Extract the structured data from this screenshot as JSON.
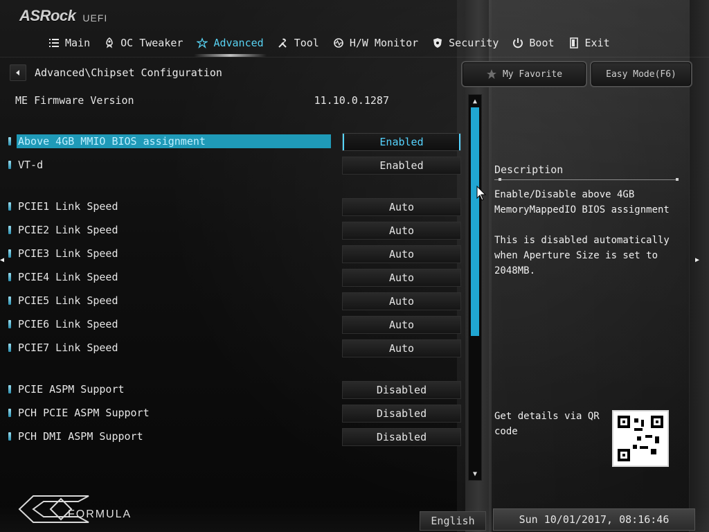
{
  "brand": {
    "name": "ASRock",
    "suffix": "UEFI"
  },
  "nav": {
    "items": [
      {
        "label": "Main",
        "icon": "list-icon"
      },
      {
        "label": "OC Tweaker",
        "icon": "rocket-icon"
      },
      {
        "label": "Advanced",
        "icon": "star-icon"
      },
      {
        "label": "Tool",
        "icon": "tools-icon"
      },
      {
        "label": "H/W Monitor",
        "icon": "monitor-icon"
      },
      {
        "label": "Security",
        "icon": "shield-icon"
      },
      {
        "label": "Boot",
        "icon": "power-icon"
      },
      {
        "label": "Exit",
        "icon": "exit-icon"
      }
    ],
    "active_index": 2,
    "accent": "#58d2f2"
  },
  "breadcrumb": {
    "path": "Advanced\\Chipset Configuration"
  },
  "firmware": {
    "label": "ME Firmware Version",
    "value": "11.10.0.1287"
  },
  "settings": [
    {
      "label": "Above 4GB MMIO BIOS assignment",
      "value": "Enabled",
      "selected": true
    },
    {
      "label": "VT-d",
      "value": "Enabled"
    },
    {
      "label": "PCIE1 Link Speed",
      "value": "Auto"
    },
    {
      "label": "PCIE2 Link Speed",
      "value": "Auto"
    },
    {
      "label": "PCIE3 Link Speed",
      "value": "Auto"
    },
    {
      "label": "PCIE4 Link Speed",
      "value": "Auto"
    },
    {
      "label": "PCIE5 Link Speed",
      "value": "Auto"
    },
    {
      "label": "PCIE6 Link Speed",
      "value": "Auto"
    },
    {
      "label": "PCIE7 Link Speed",
      "value": "Auto"
    },
    {
      "label": "PCIE ASPM Support",
      "value": "Disabled"
    },
    {
      "label": "PCH PCIE ASPM Support",
      "value": "Disabled"
    },
    {
      "label": "PCH DMI ASPM Support",
      "value": "Disabled"
    }
  ],
  "buttons": {
    "my_favorite": "My Favorite",
    "easy_mode": "Easy Mode(F6)"
  },
  "description": {
    "title": "Description",
    "text": "Enable/Disable above 4GB\nMemoryMappedIO BIOS assignment\n\nThis is disabled automatically\nwhen Aperture Size is set to\n2048MB.",
    "qr_text": "Get details via QR\ncode"
  },
  "footer": {
    "formula": "FORMULA",
    "language": "English",
    "datetime": "Sun 10/01/2017, 08:16:46"
  }
}
